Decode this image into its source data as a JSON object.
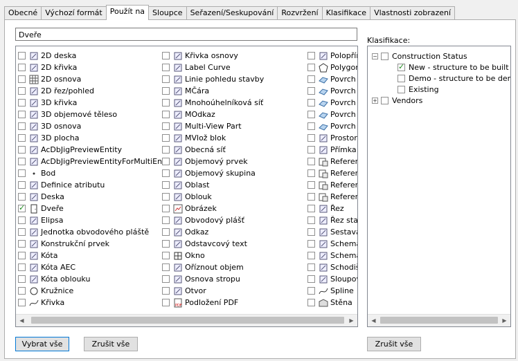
{
  "tabs": [
    "Obecné",
    "Výchozí formát",
    "Použít na",
    "Sloupce",
    "Seřazení/Seskupování",
    "Rozvržení",
    "Klasifikace",
    "Vlastnosti zobrazení"
  ],
  "active_tab_index": 2,
  "filter_value": "Dveře",
  "object_list": {
    "col1": [
      {
        "label": "2D deska",
        "icon": "slab-icon",
        "checked": false
      },
      {
        "label": "2D křivka",
        "icon": "curve-icon",
        "checked": false
      },
      {
        "label": "2D osnova",
        "icon": "grid-icon",
        "checked": false
      },
      {
        "label": "2D řez/pohled",
        "icon": "section-icon",
        "checked": false
      },
      {
        "label": "3D křivka",
        "icon": "3d-curve-icon",
        "checked": false
      },
      {
        "label": "3D objemové těleso",
        "icon": "solid-icon",
        "checked": false
      },
      {
        "label": "3D osnova",
        "icon": "3d-grid-icon",
        "checked": false
      },
      {
        "label": "3D plocha",
        "icon": "face-icon",
        "checked": false
      },
      {
        "label": "AcDbJigPreviewEntity",
        "icon": "entity-icon",
        "checked": false
      },
      {
        "label": "AcDbJigPreviewEntityForMultiEnts",
        "icon": "entity-icon",
        "checked": false
      },
      {
        "label": "Bod",
        "icon": "point-icon",
        "checked": false
      },
      {
        "label": "Definice atributu",
        "icon": "attribute-icon",
        "checked": false
      },
      {
        "label": "Deska",
        "icon": "slab-icon",
        "checked": false
      },
      {
        "label": "Dveře",
        "icon": "door-icon",
        "checked": true
      },
      {
        "label": "Elipsa",
        "icon": "ellipse-icon",
        "checked": false
      },
      {
        "label": "Jednotka obvodového pláště",
        "icon": "curtain-unit-icon",
        "checked": false
      },
      {
        "label": "Konstrukční prvek",
        "icon": "member-icon",
        "checked": false
      },
      {
        "label": "Kóta",
        "icon": "dimension-icon",
        "checked": false
      },
      {
        "label": "Kóta AEC",
        "icon": "aec-dimension-icon",
        "checked": false
      },
      {
        "label": "Kóta oblouku",
        "icon": "arc-dimension-icon",
        "checked": false
      },
      {
        "label": "Kružnice",
        "icon": "circle-icon",
        "checked": false
      },
      {
        "label": "Křivka",
        "icon": "spline-icon",
        "checked": false
      }
    ],
    "col2": [
      {
        "label": "Křivka osnovy",
        "icon": "grid-curve-icon",
        "checked": false
      },
      {
        "label": "Label Curve",
        "icon": "label-curve-icon",
        "checked": false
      },
      {
        "label": "Linie pohledu stavby",
        "icon": "line-icon",
        "checked": false
      },
      {
        "label": "MČára",
        "icon": "mline-icon",
        "checked": false
      },
      {
        "label": "Mnohoúhelníková síť",
        "icon": "mesh-icon",
        "checked": false
      },
      {
        "label": "MOdkaz",
        "icon": "mref-icon",
        "checked": false
      },
      {
        "label": "Multi-View Part",
        "icon": "mvpart-icon",
        "checked": false
      },
      {
        "label": "MVlož blok",
        "icon": "mblock-icon",
        "checked": false
      },
      {
        "label": "Obecná síť",
        "icon": "net-icon",
        "checked": false
      },
      {
        "label": "Objemový prvek",
        "icon": "mass-element-icon",
        "checked": false
      },
      {
        "label": "Objemový skupina",
        "icon": "mass-group-icon",
        "checked": false
      },
      {
        "label": "Oblast",
        "icon": "region-icon",
        "checked": false
      },
      {
        "label": "Oblouk",
        "icon": "arc-icon",
        "checked": false
      },
      {
        "label": "Obrázek",
        "icon": "image-icon",
        "checked": false
      },
      {
        "label": "Obvodový plášť",
        "icon": "curtain-wall-icon",
        "checked": false
      },
      {
        "label": "Odkaz",
        "icon": "leader-icon",
        "checked": false
      },
      {
        "label": "Odstavcový text",
        "icon": "mtext-icon",
        "checked": false
      },
      {
        "label": "Okno",
        "icon": "window-icon",
        "checked": false
      },
      {
        "label": "Oříznout objem",
        "icon": "clip-volume-icon",
        "checked": false
      },
      {
        "label": "Osnova stropu",
        "icon": "ceiling-grid-icon",
        "checked": false
      },
      {
        "label": "Otvor",
        "icon": "opening-icon",
        "checked": false
      },
      {
        "label": "Podložení PDF",
        "icon": "pdf-icon",
        "checked": false
      }
    ],
    "col3": [
      {
        "label": "Polopřím",
        "icon": "ray-icon",
        "checked": false
      },
      {
        "label": "Polygon",
        "icon": "polygon-icon",
        "checked": false
      },
      {
        "label": "Povrch",
        "icon": "surface-icon",
        "checked": false
      },
      {
        "label": "Povrch",
        "icon": "surface-icon",
        "checked": false
      },
      {
        "label": "Povrch",
        "icon": "surface-icon",
        "checked": false
      },
      {
        "label": "Povrch",
        "icon": "surface-icon",
        "checked": false
      },
      {
        "label": "Povrch",
        "icon": "surface-icon",
        "checked": false
      },
      {
        "label": "Prostor",
        "icon": "space-icon",
        "checked": false
      },
      {
        "label": "Přímka",
        "icon": "xline-icon",
        "checked": false
      },
      {
        "label": "Referen",
        "icon": "reference-icon",
        "checked": false
      },
      {
        "label": "Referen",
        "icon": "reference-icon",
        "checked": false
      },
      {
        "label": "Referen",
        "icon": "reference-icon",
        "checked": false
      },
      {
        "label": "Referen",
        "icon": "reference-icon",
        "checked": false
      },
      {
        "label": "Řez",
        "icon": "cut-icon",
        "checked": false
      },
      {
        "label": "Řez stav",
        "icon": "building-section-icon",
        "checked": false
      },
      {
        "label": "Sestava",
        "icon": "assembly-icon",
        "checked": false
      },
      {
        "label": "Schema",
        "icon": "schematic-icon",
        "checked": false
      },
      {
        "label": "Schema",
        "icon": "schematic-icon",
        "checked": false
      },
      {
        "label": "Schodiš",
        "icon": "stair-icon",
        "checked": false
      },
      {
        "label": "Sloupov",
        "icon": "column-grid-icon",
        "checked": false
      },
      {
        "label": "Spline",
        "icon": "spline-icon",
        "checked": false
      },
      {
        "label": "Stěna",
        "icon": "wall-icon",
        "checked": false
      }
    ]
  },
  "klasifikace_label": "Klasifikace:",
  "tree": {
    "root": {
      "label": "Construction Status",
      "checked": false
    },
    "children": [
      {
        "label": "New - structure to be built",
        "checked": true
      },
      {
        "label": "Demo - structure to be demolis",
        "checked": false
      },
      {
        "label": "Existing",
        "checked": false
      }
    ],
    "second": {
      "label": "Vendors",
      "checked": false
    }
  },
  "buttons": {
    "select_all": "Vybrat vše",
    "clear_all": "Zrušit vše",
    "clear_all_right": "Zrušit vše"
  },
  "colors": {
    "accent": "#0078d7",
    "check": "#1a8a1a"
  }
}
